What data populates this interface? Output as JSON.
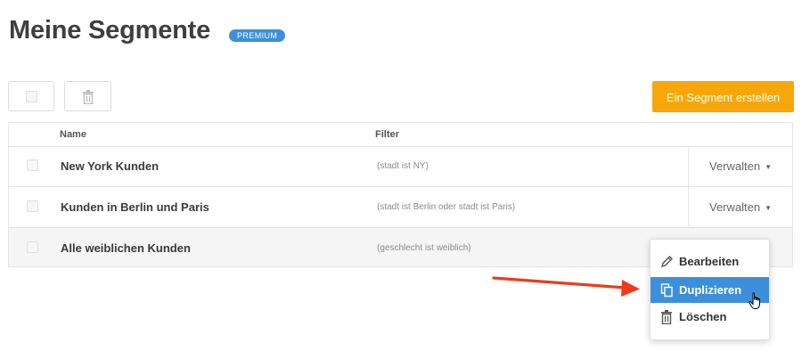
{
  "header": {
    "title": "Meine Segmente",
    "badge": "PREMIUM"
  },
  "toolbar": {
    "create_label": "Ein Segment erstellen"
  },
  "table": {
    "columns": [
      "Name",
      "Filter"
    ],
    "rows": [
      {
        "name": "New York Kunden",
        "filter": "(stadt ist NY)",
        "action": "Verwalten"
      },
      {
        "name": "Kunden in Berlin und Paris",
        "filter": "(stadt ist Berlin oder stadt ist Paris)",
        "action": "Verwalten"
      },
      {
        "name": "Alle weiblichen Kunden",
        "filter": "(geschlecht ist weiblich)",
        "action": ""
      }
    ]
  },
  "dropdown": {
    "items": [
      {
        "label": "Bearbeiten",
        "icon": "pencil-icon"
      },
      {
        "label": "Duplizieren",
        "icon": "copy-icon",
        "highlighted": true
      },
      {
        "label": "Löschen",
        "icon": "trash-icon"
      }
    ]
  },
  "colors": {
    "accent": "#f7a70a",
    "badge": "#3e8fd8",
    "highlight": "#3d8fdc",
    "annotation_arrow": "#ee3a1c"
  }
}
